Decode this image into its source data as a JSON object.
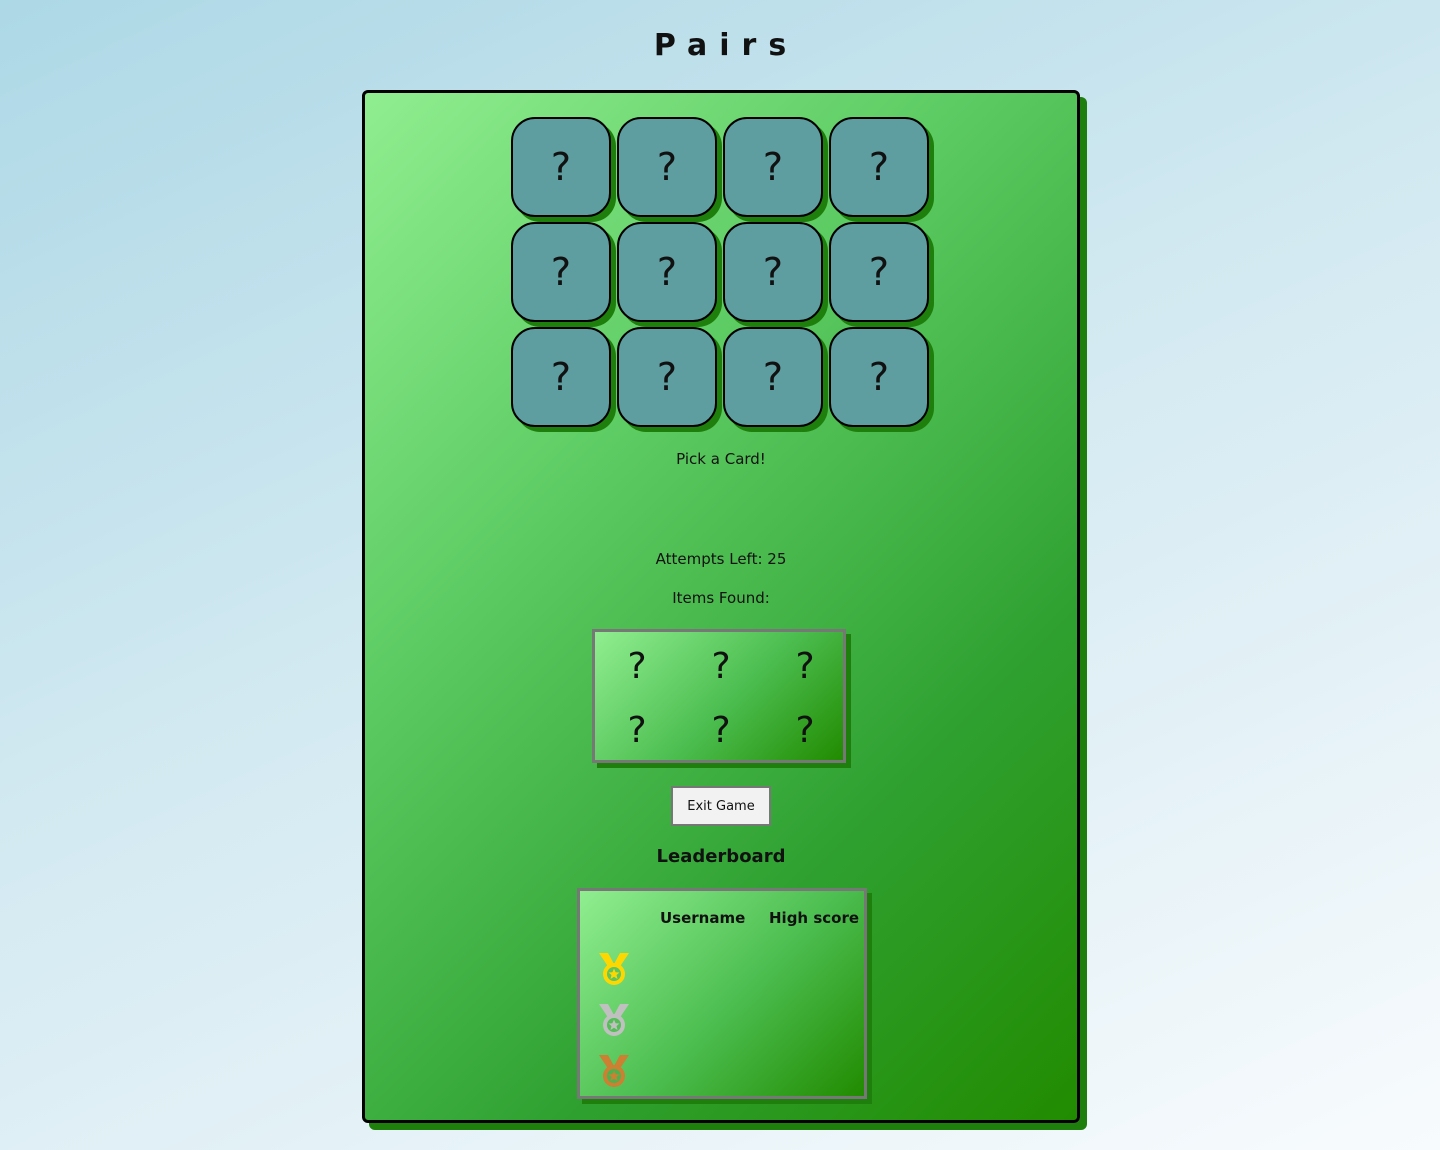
{
  "header": {
    "title": "Pairs"
  },
  "board": {
    "cards": [
      "?",
      "?",
      "?",
      "?",
      "?",
      "?",
      "?",
      "?",
      "?",
      "?",
      "?",
      "?"
    ],
    "status_message": "Pick a Card!",
    "attempts_label": "Attempts Left: 25",
    "items_found_label": "Items Found:",
    "items_found": [
      "?",
      "?",
      "?",
      "?",
      "?",
      "?"
    ],
    "exit_button_label": "Exit Game"
  },
  "leaderboard": {
    "title": "Leaderboard",
    "columns": {
      "username": "Username",
      "high_score": "High score"
    },
    "rows": [
      {
        "rank_icon": "gold-medal-icon",
        "color": "#FFD700",
        "username": "",
        "score": ""
      },
      {
        "rank_icon": "silver-medal-icon",
        "color": "#C0C0C0",
        "username": "",
        "score": ""
      },
      {
        "rank_icon": "bronze-medal-icon",
        "color": "#CD7F32",
        "username": "",
        "score": ""
      }
    ]
  },
  "colors": {
    "card_back": "#5F9EA0",
    "board_light": "#90EE90",
    "board_dark": "#218B00"
  }
}
